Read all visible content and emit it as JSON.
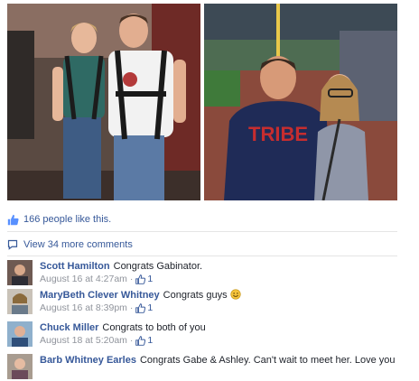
{
  "post": {
    "likes_text": "166 people like this.",
    "view_more_text": "View 34 more comments"
  },
  "comments": [
    {
      "name": "Scott Hamilton",
      "text": "Congrats Gabinator.",
      "time": "August 16 at 4:27am",
      "likes": "1"
    },
    {
      "name": "MaryBeth Clever Whitney",
      "text": "Congrats guys",
      "time": "August 16 at 8:39pm",
      "likes": "1"
    },
    {
      "name": "Chuck Miller",
      "text": "Congrats to both of you",
      "time": "August 18 at 5:20am",
      "likes": "1"
    },
    {
      "name": "Barb Whitney Earles",
      "text": "Congrats Gabe & Ashley. Can't wait to meet her. Love you",
      "time": "",
      "likes": ""
    }
  ],
  "photo_right": {
    "shirt_text": "TRIBE"
  },
  "colors": {
    "link": "#365899",
    "meta": "#90949c"
  }
}
